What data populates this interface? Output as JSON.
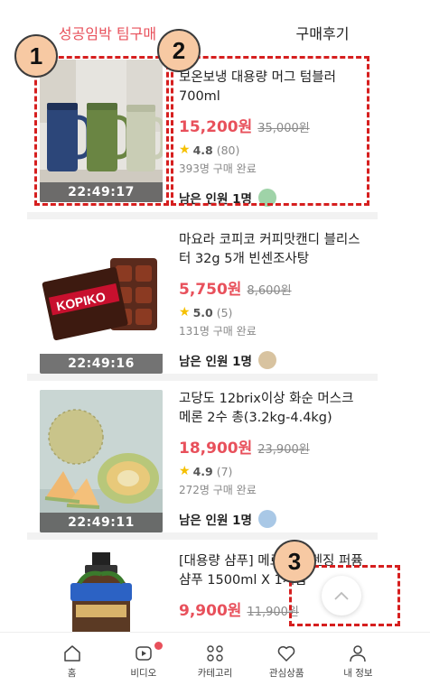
{
  "tabs": [
    {
      "label": "성공임박 팀구매",
      "active": true
    },
    {
      "label": "구매후기",
      "active": false
    }
  ],
  "products": [
    {
      "title": "보온보냉 대용량 머그 텀블러 700ml",
      "price": "15,200원",
      "original_price": "35,000원",
      "rating": "4.8",
      "reviews": "(80)",
      "sold": "393명 구매 완료",
      "remaining": "남은 인원 1명",
      "timer": "22:49:17"
    },
    {
      "title": "마요라 코피코 커피맛캔디 블리스터 32g 5개 빈센조사탕",
      "price": "5,750원",
      "original_price": "8,600원",
      "rating": "5.0",
      "reviews": "(5)",
      "sold": "131명 구매 완료",
      "remaining": "남은 인원 1명",
      "timer": "22:49:16",
      "brand_text": "KOPIKO"
    },
    {
      "title": "고당도 12brix이상 화순 머스크 메론 2수 총(3.2kg-4.4kg)",
      "price": "18,900원",
      "original_price": "23,900원",
      "rating": "4.9",
      "reviews": "(7)",
      "sold": "272명 구매 완료",
      "remaining": "남은 인원 1명",
      "timer": "22:49:11"
    },
    {
      "title": "[대용량 샴푸] 메르... 클렌징 퍼퓸 샴푸 1500ml X 1개입",
      "price": "9,900원",
      "original_price": "11,900원"
    }
  ],
  "annotations": [
    "1",
    "2",
    "3"
  ],
  "bottom_nav": [
    {
      "label": "홈",
      "icon": "home-icon"
    },
    {
      "label": "비디오",
      "icon": "video-icon"
    },
    {
      "label": "카테고리",
      "icon": "category-icon"
    },
    {
      "label": "관심상품",
      "icon": "heart-icon"
    },
    {
      "label": "내 정보",
      "icon": "user-icon"
    }
  ],
  "colors": {
    "accent": "#e8505b",
    "annotation": "#d61f1f",
    "badge": "#f7c9a3"
  }
}
